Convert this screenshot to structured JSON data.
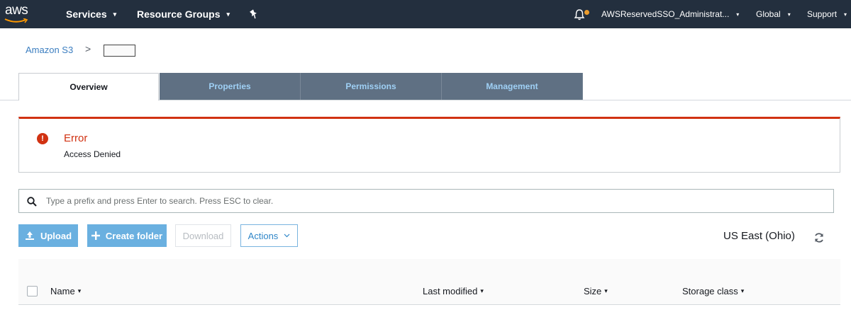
{
  "nav": {
    "logo_text": "aws",
    "services_label": "Services",
    "resource_groups_label": "Resource Groups",
    "account_label": "AWSReservedSSO_Administrat...",
    "region_label": "Global",
    "support_label": "Support",
    "caret": "▾"
  },
  "breadcrumb": {
    "root": "Amazon S3",
    "separator": ">"
  },
  "tabs": [
    {
      "label": "Overview",
      "active": true
    },
    {
      "label": "Properties",
      "active": false
    },
    {
      "label": "Permissions",
      "active": false
    },
    {
      "label": "Management",
      "active": false
    }
  ],
  "error": {
    "icon": "!",
    "title": "Error",
    "message": "Access Denied"
  },
  "search": {
    "placeholder": "Type a prefix and press Enter to search. Press ESC to clear.",
    "value": ""
  },
  "actions": {
    "upload": "Upload",
    "create_folder": "Create folder",
    "download": "Download",
    "actions": "Actions"
  },
  "region_display": "US East (Ohio)",
  "table": {
    "columns": [
      "Name",
      "Last modified",
      "Size",
      "Storage class"
    ]
  },
  "colors": {
    "nav_bg": "#232f3e",
    "error_red": "#d13212",
    "primary_btn": "#6ab0e0",
    "link_blue": "#3b7ec0",
    "tab_inactive_bg": "#5f7083"
  },
  "icons": [
    "bell-icon",
    "pin-icon",
    "exclamation-icon",
    "search-icon",
    "upload-icon",
    "plus-icon",
    "refresh-icon",
    "chevron-down-icon"
  ]
}
